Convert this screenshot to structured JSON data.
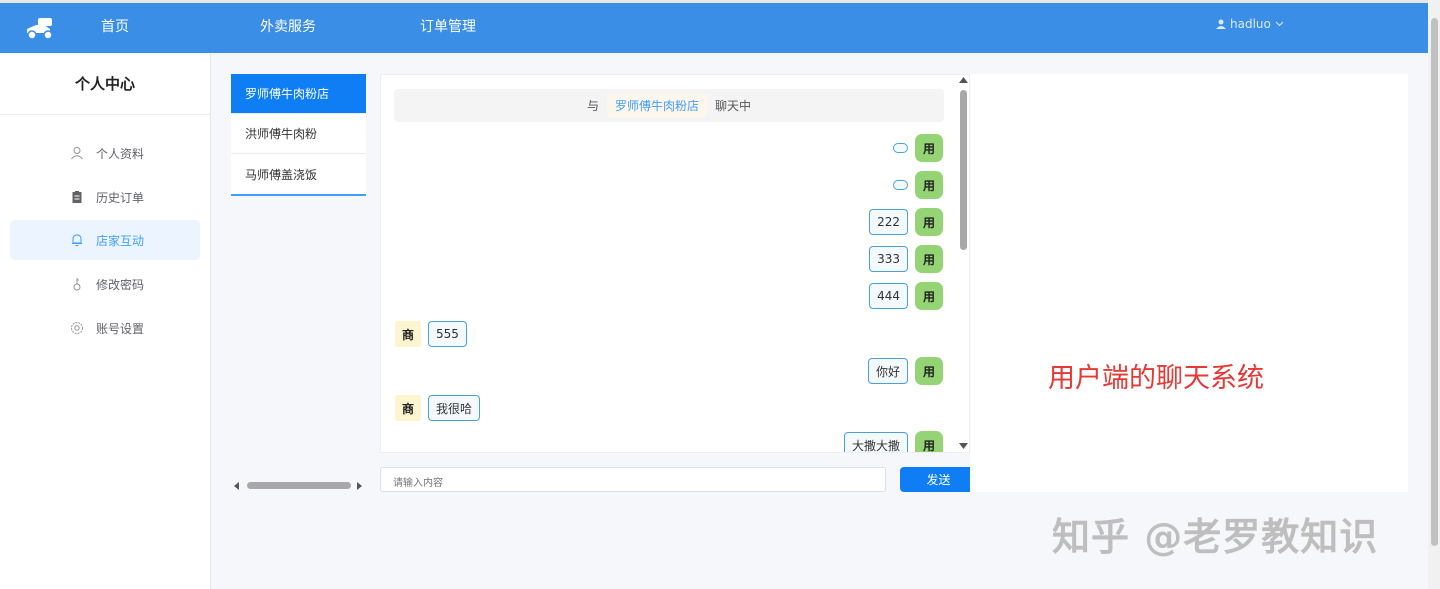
{
  "nav": {
    "items": [
      "首页",
      "外卖服务",
      "订单管理"
    ],
    "user": "hadluo"
  },
  "sidebar": {
    "title": "个人中心",
    "items": [
      {
        "label": "个人资料",
        "icon": "user-icon"
      },
      {
        "label": "历史订单",
        "icon": "clipboard-icon"
      },
      {
        "label": "店家互动",
        "icon": "bell-icon",
        "active": true
      },
      {
        "label": "修改密码",
        "icon": "key-icon"
      },
      {
        "label": "账号设置",
        "icon": "gear-icon"
      }
    ]
  },
  "shops": [
    "罗师傅牛肉粉店",
    "洪师傅牛肉粉",
    "马师傅盖浇饭"
  ],
  "chat": {
    "header_prefix": "与",
    "shop_name": "罗师傅牛肉粉店",
    "header_suffix": "聊天中",
    "user_avatar": "用",
    "merchant_avatar": "商",
    "messages": [
      {
        "from": "user",
        "text": ""
      },
      {
        "from": "user",
        "text": ""
      },
      {
        "from": "user",
        "text": "222"
      },
      {
        "from": "user",
        "text": "333"
      },
      {
        "from": "user",
        "text": "444"
      },
      {
        "from": "merchant",
        "text": "555"
      },
      {
        "from": "user",
        "text": "你好"
      },
      {
        "from": "merchant",
        "text": "我很哈"
      },
      {
        "from": "user",
        "text": "大撒大撒"
      }
    ],
    "input_placeholder": "请输入内容",
    "send_label": "发送"
  },
  "annotation": "用户端的聊天系统",
  "watermark": "知乎 @老罗教知识",
  "colors": {
    "primary": "#3a8ee6",
    "button": "#0f7ef5",
    "user_avatar": "#95d475",
    "merchant_avatar": "#fdf4d0",
    "caption": "#e53935"
  }
}
